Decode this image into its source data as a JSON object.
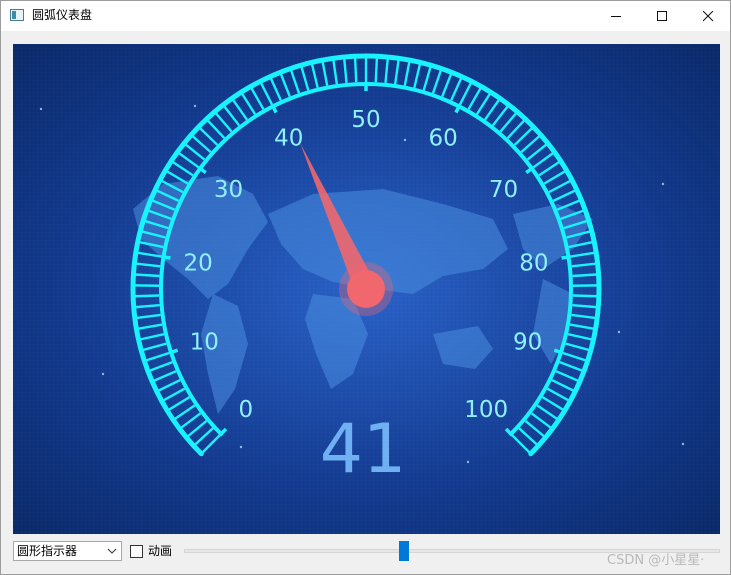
{
  "window": {
    "title": "圆弧仪表盘",
    "icons": {
      "app": "app-window-icon",
      "minimize": "minimize-icon",
      "maximize": "maximize-icon",
      "close": "close-icon"
    }
  },
  "gauge": {
    "min": 0,
    "max": 100,
    "value": 41,
    "value_text": "41",
    "scale_labels": [
      "0",
      "10",
      "20",
      "30",
      "40",
      "50",
      "60",
      "70",
      "80",
      "90",
      "100"
    ],
    "colors": {
      "arc": "#19f2ff",
      "pointer": "#f0676d",
      "value_text": "#6fb0f2",
      "background_center": "#2a62c8",
      "background_edge": "#0b2a6a"
    }
  },
  "controls": {
    "combo_value": "圆形指示器",
    "animation_label": "动画",
    "animation_checked": false,
    "slider_value": 41
  },
  "watermark": "CSDN @小星星·"
}
